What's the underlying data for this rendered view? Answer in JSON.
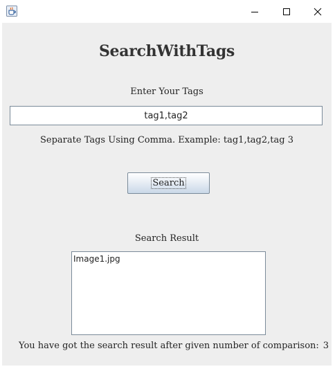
{
  "window": {
    "app_icon": "java-coffee-cup-icon",
    "controls": [
      "minimize-icon",
      "maximize-icon",
      "close-icon"
    ]
  },
  "app": {
    "title": "SearchWithTags",
    "tags_label": "Enter Your Tags",
    "tags_value": "tag1,tag2",
    "hint": "Separate Tags Using Comma. Example: tag1,tag2,tag 3",
    "search_button": "Search",
    "result_label": "Search Result",
    "results": [
      "Image1.jpg"
    ],
    "footer_text": "You have got the search result after given number of comparison:",
    "comparison_count": "3"
  },
  "colors": {
    "panel_background": "#eeeeee",
    "border": "#7a8a99"
  }
}
